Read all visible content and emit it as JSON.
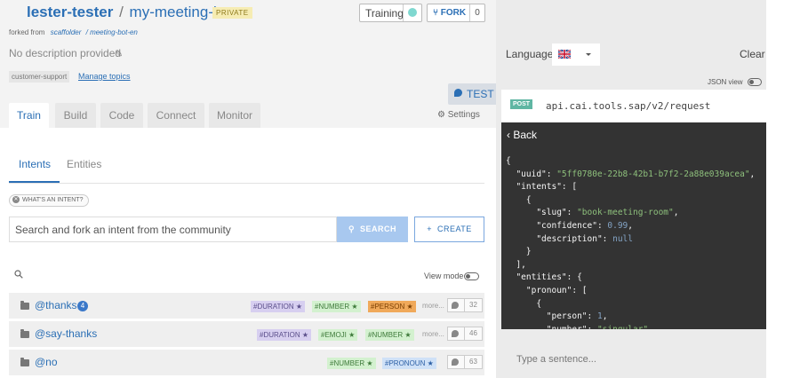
{
  "repo": {
    "owner": "lester-tester",
    "separator": "/",
    "name": "my-meeting-bot",
    "visibility": "PRIVATE"
  },
  "header_actions": {
    "training_label": "Training",
    "fork_label": "FORK",
    "fork_count": "0"
  },
  "forked_from": {
    "prefix": "forked from",
    "source_owner": "scaffolder",
    "source_repo": "/ meeting-bot-en"
  },
  "description": "No description provided",
  "topics": {
    "badge": "customer-support",
    "manage_label": "Manage topics"
  },
  "test_label": "TEST",
  "tabs": [
    {
      "label": "Train",
      "active": true
    },
    {
      "label": "Build"
    },
    {
      "label": "Code"
    },
    {
      "label": "Connect"
    },
    {
      "label": "Monitor"
    }
  ],
  "settings_label": "Settings",
  "subtabs": [
    {
      "label": "Intents",
      "active": true
    },
    {
      "label": "Entities"
    }
  ],
  "what_intent_label": "WHAT'S AN INTENT?",
  "search": {
    "placeholder": "Search and fork an intent from the community",
    "search_label": "SEARCH",
    "create_label": "CREATE"
  },
  "view_mode_label": "View mode",
  "intents": [
    {
      "name": "@thanks",
      "badge": "4",
      "entities": [
        {
          "label": "#DURATION ★",
          "color": "purple"
        },
        {
          "label": "#NUMBER ★",
          "color": "green"
        },
        {
          "label": "#PERSON ★",
          "color": "orange"
        }
      ],
      "more": "more...",
      "expressions": "32"
    },
    {
      "name": "@say-thanks",
      "entities": [
        {
          "label": "#DURATION ★",
          "color": "purple"
        },
        {
          "label": "#EMOJI ★",
          "color": "green"
        },
        {
          "label": "#NUMBER ★",
          "color": "green"
        }
      ],
      "more": "more...",
      "expressions": "46"
    },
    {
      "name": "@no",
      "entities": [
        {
          "label": "#NUMBER ★",
          "color": "green"
        },
        {
          "label": "#PRONOUN ★",
          "color": "blue"
        }
      ],
      "expressions": "63"
    }
  ],
  "tester": {
    "language_label": "Language",
    "language_flag": "uk-flag",
    "clear_label": "Clear",
    "json_view_label": "JSON view",
    "method": "POST",
    "url": "api.cai.tools.sap/v2/request",
    "back_label": "Back",
    "json_lines": [
      "{",
      "  \"uuid\": \"5ff0780e-22b8-42b1-b7f2-2a88e039acea\",",
      "  \"intents\": [",
      "    {",
      "      \"slug\": \"book-meeting-room\",",
      "      \"confidence\": 0.99,",
      "      \"description\": null",
      "    }",
      "  ],",
      "  \"entities\": {",
      "    \"pronoun\": [",
      "      {",
      "        \"person\": 1,",
      "        \"number\": \"singular\","
    ],
    "sentence_placeholder": "Type a sentence..."
  },
  "colors": {
    "accent": "#2b6fb5",
    "post": "#5fb6a3",
    "code_bg": "#333333"
  }
}
